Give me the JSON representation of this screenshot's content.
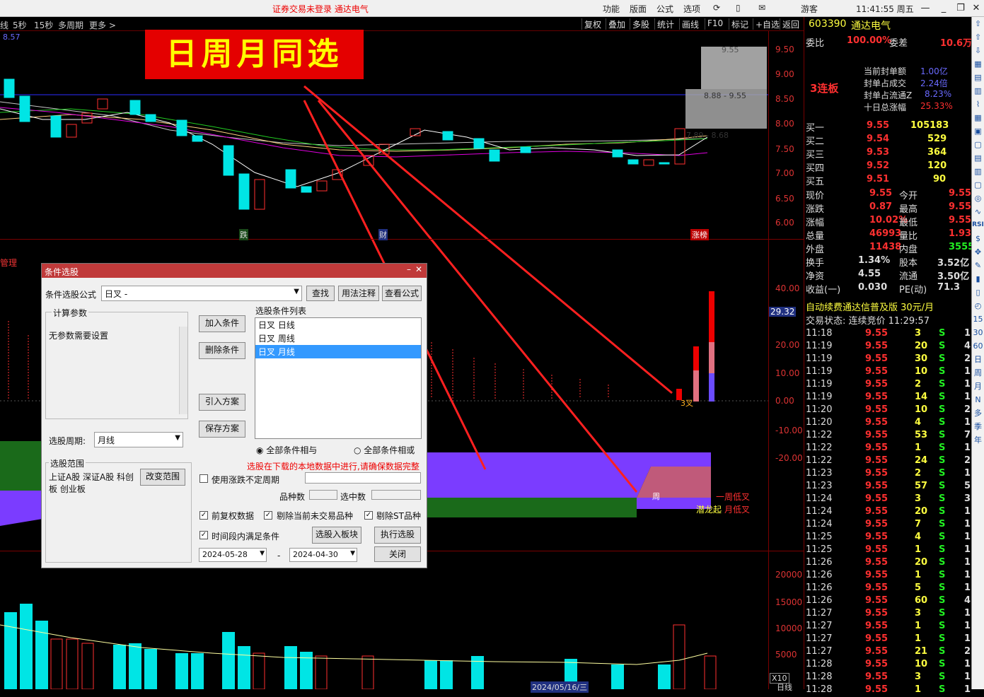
{
  "titlebar": {
    "center": "证券交易未登录  通达电气",
    "menus": [
      "功能",
      "版面",
      "公式",
      "选项"
    ],
    "user": "游客",
    "clock": "11:41:55 周五"
  },
  "toolbar": {
    "periods": [
      "线",
      "5秒",
      "15秒",
      "多周期",
      "更多 >"
    ],
    "tools": [
      "复权",
      "叠加",
      "多股",
      "统计",
      "画线",
      "F10",
      "标记",
      "+自选",
      "返回"
    ],
    "ma_readout": "8.57"
  },
  "banner": "日周月同选",
  "price_axis": [
    "9.50",
    "9.00",
    "8.50",
    "8.00",
    "7.50",
    "7.00",
    "6.50",
    "6.00"
  ],
  "chart_labels": {
    "range_hi": "9.55",
    "range_mid": "8.88 - 9.55",
    "range_lo": "7.89 - 8.68",
    "tag_down": "跌",
    "tag_fin": "财",
    "tag_limit": "涨榜",
    "indicator_title": "管理",
    "cross3": "3叉",
    "week_cross": "周",
    "week_low": "一周低叉",
    "dragon": "潜龙起",
    "month_low": "月低叉",
    "ind_value": "29.32",
    "vol_unit": "X10",
    "vol_date": "2024/05/16/三",
    "vol_period": "日线"
  },
  "ind_axis": [
    "40.00",
    "20.00",
    "10.00",
    "0.00",
    "-10.00",
    "-20.00"
  ],
  "vol_axis": [
    "20000",
    "15000",
    "10000",
    "5000"
  ],
  "stock": {
    "code": "603390",
    "name": "通达电气",
    "wb_label": "委比",
    "wb": "100.00%",
    "wc_label": "委差",
    "wc": "10.6万",
    "streak": "3连板",
    "seal_lines": [
      [
        "当前封单额",
        "1.00亿"
      ],
      [
        "封单占成交",
        "2.24倍"
      ],
      [
        "封单占流通Z",
        "8.23%"
      ],
      [
        "十日总涨幅",
        "25.33%"
      ]
    ],
    "bids": [
      [
        "买一",
        "9.55",
        "105183"
      ],
      [
        "买二",
        "9.54",
        "529"
      ],
      [
        "买三",
        "9.53",
        "364"
      ],
      [
        "买四",
        "9.52",
        "120"
      ],
      [
        "买五",
        "9.51",
        "90"
      ]
    ],
    "quotes": [
      [
        "现价",
        "9.55",
        "今开",
        "9.55"
      ],
      [
        "涨跌",
        "0.87",
        "最高",
        "9.55"
      ],
      [
        "涨幅",
        "10.02%",
        "最低",
        "9.55"
      ],
      [
        "总量",
        "46993",
        "量比",
        "1.93"
      ],
      [
        "外盘",
        "11438",
        "内盘",
        "35555"
      ],
      [
        "换手",
        "1.34%",
        "股本",
        "3.52亿"
      ],
      [
        "净资",
        "4.55",
        "流通",
        "3.50亿"
      ],
      [
        "收益(一)",
        "0.030",
        "PE(动)",
        "71.3"
      ]
    ],
    "promo": "自动续费通达信普及版  30元/月",
    "status": "交易状态: 连续竞价  11:29:57",
    "ticks": [
      [
        "11:18",
        "9.55",
        "3",
        "S",
        "1"
      ],
      [
        "11:19",
        "9.55",
        "20",
        "S",
        "4"
      ],
      [
        "11:19",
        "9.55",
        "30",
        "S",
        "2"
      ],
      [
        "11:19",
        "9.55",
        "10",
        "S",
        "1"
      ],
      [
        "11:19",
        "9.55",
        "2",
        "S",
        "1"
      ],
      [
        "11:19",
        "9.55",
        "14",
        "S",
        "1"
      ],
      [
        "11:20",
        "9.55",
        "10",
        "S",
        "2"
      ],
      [
        "11:20",
        "9.55",
        "4",
        "S",
        "1"
      ],
      [
        "11:22",
        "9.55",
        "53",
        "S",
        "7"
      ],
      [
        "11:22",
        "9.55",
        "1",
        "S",
        "1"
      ],
      [
        "11:22",
        "9.55",
        "24",
        "S",
        "2"
      ],
      [
        "11:23",
        "9.55",
        "2",
        "S",
        "1"
      ],
      [
        "11:23",
        "9.55",
        "57",
        "S",
        "5"
      ],
      [
        "11:24",
        "9.55",
        "3",
        "S",
        "3"
      ],
      [
        "11:24",
        "9.55",
        "20",
        "S",
        "1"
      ],
      [
        "11:24",
        "9.55",
        "7",
        "S",
        "1"
      ],
      [
        "11:25",
        "9.55",
        "4",
        "S",
        "1"
      ],
      [
        "11:25",
        "9.55",
        "1",
        "S",
        "1"
      ],
      [
        "11:26",
        "9.55",
        "20",
        "S",
        "1"
      ],
      [
        "11:26",
        "9.55",
        "1",
        "S",
        "1"
      ],
      [
        "11:26",
        "9.55",
        "5",
        "S",
        "1"
      ],
      [
        "11:26",
        "9.55",
        "60",
        "S",
        "4"
      ],
      [
        "11:27",
        "9.55",
        "3",
        "S",
        "1"
      ],
      [
        "11:27",
        "9.55",
        "1",
        "S",
        "1"
      ],
      [
        "11:27",
        "9.55",
        "1",
        "S",
        "1"
      ],
      [
        "11:27",
        "9.55",
        "21",
        "S",
        "2"
      ],
      [
        "11:28",
        "9.55",
        "10",
        "S",
        "1"
      ],
      [
        "11:28",
        "9.55",
        "3",
        "S",
        "1"
      ],
      [
        "11:28",
        "9.55",
        "1",
        "S",
        "1"
      ]
    ]
  },
  "sidebar": [
    "RSI",
    "15",
    "30",
    "60",
    "日",
    "周",
    "月",
    "N",
    "多",
    "季",
    "年"
  ],
  "dialog": {
    "title": "条件选股",
    "formula_label": "条件选股公式",
    "formula_value": "日叉  -",
    "find": "查找",
    "usage": "用法注释",
    "view_formula": "查看公式",
    "params_group": "计算参数",
    "params_text": "无参数需要设置",
    "add": "加入条件",
    "delete": "删除条件",
    "import": "引入方案",
    "save": "保存方案",
    "list_label": "选股条件列表",
    "conditions": [
      "日叉  日线",
      "日叉  周线",
      "日叉  月线"
    ],
    "and_label": "全部条件相与",
    "or_label": "全部条件相或",
    "period_label": "选股周期:",
    "period_value": "月线",
    "warning": "选股在下载的本地数据中进行,请确保数据完整",
    "scope_group": "选股范围",
    "scope_text": "上证A股 深证A股 科创板 创业板",
    "change_scope": "改变范围",
    "use_range": "使用涨跌不定周期",
    "count_label": "品种数",
    "selected_label": "选中数",
    "pre_adjust": "前复权数据",
    "exclude_untraded": "剔除当前未交易品种",
    "exclude_st": "剔除ST品种",
    "in_period": "时间段内满足条件",
    "to_block": "选股入板块",
    "execute": "执行选股",
    "date_from": "2024-05-28",
    "date_to": "2024-04-30",
    "dash": "-",
    "close": "关闭"
  }
}
